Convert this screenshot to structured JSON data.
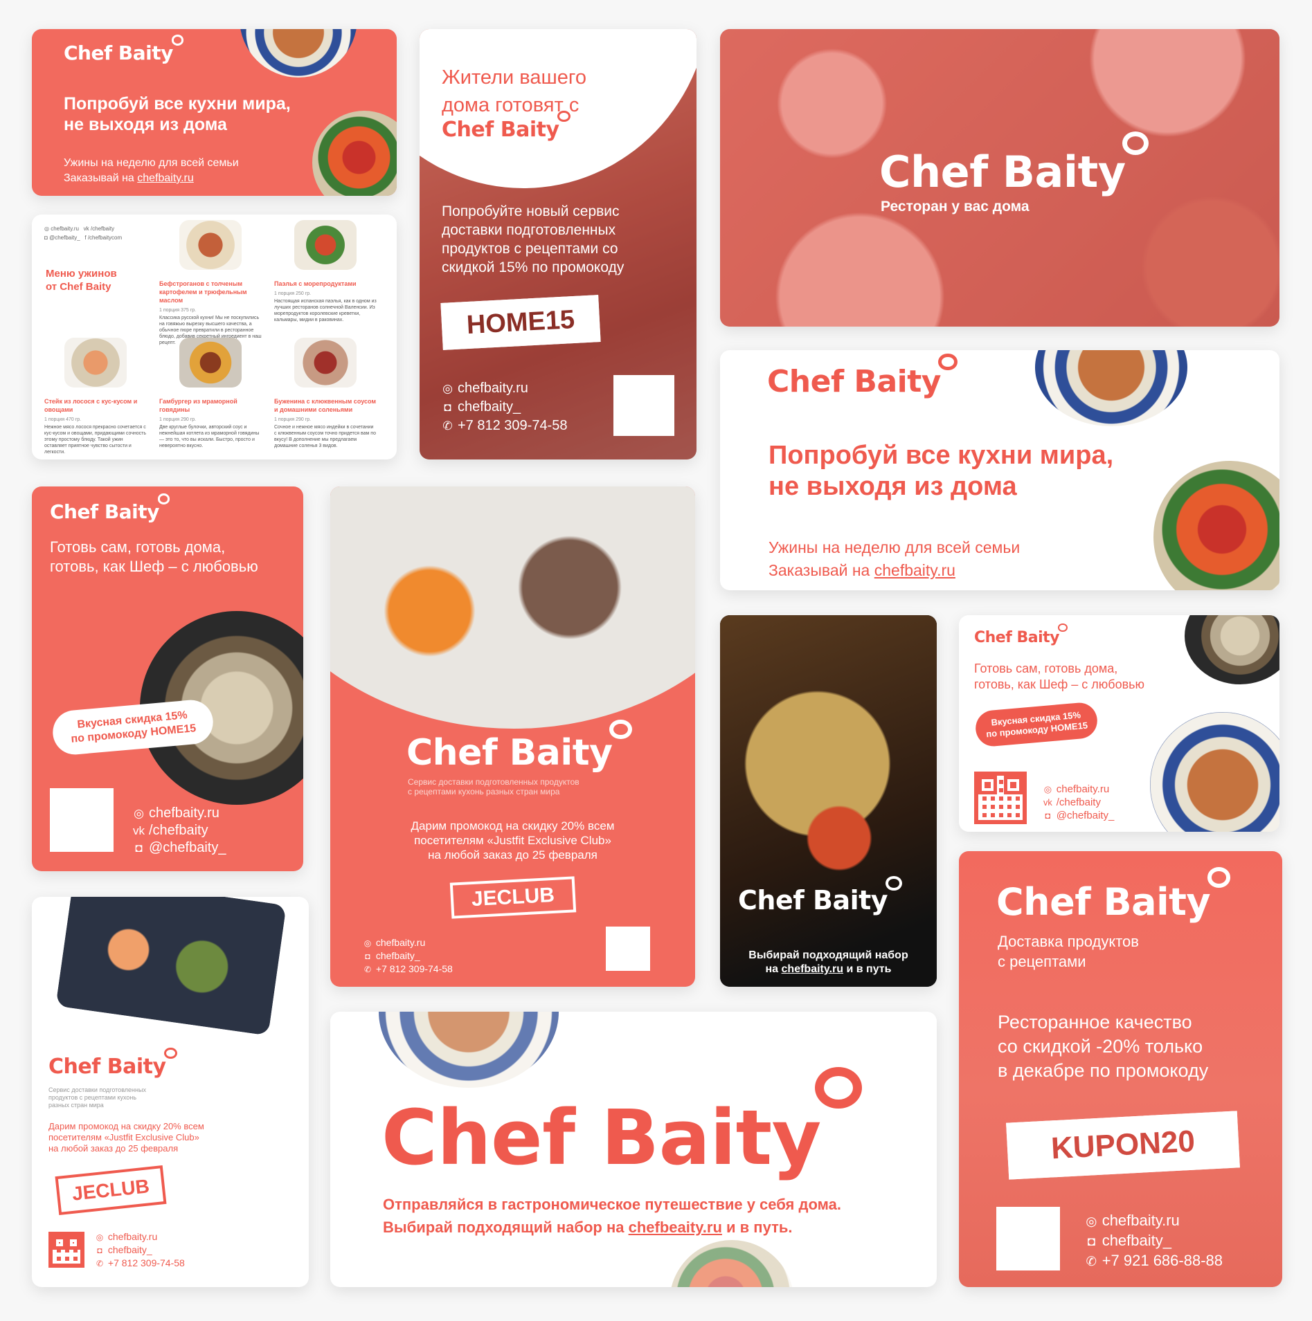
{
  "brand": {
    "name": "Chef Baity",
    "accent": "#f26a5e",
    "accent_text": "#ef5a4e"
  },
  "card1": {
    "headline": "Попробуй все кухни мира,\nне выходя из дома",
    "line1": "Ужины на неделю для всей семьи",
    "line2_prefix": "Заказывай на ",
    "link": "chefbaity.ru"
  },
  "card_menu": {
    "header": {
      "site": "chefbaity.ru",
      "insta": "@chefbaity_",
      "vk": "/chefbaity",
      "fb": "/chefbaitycom"
    },
    "title": "Меню ужинов\nот Chef Baity",
    "items": [
      {
        "title": "Бефстроганов с толченым картофелем и трюфельным маслом",
        "portion": "1 порция 375 гр.",
        "desc": "Классика русской кухни! Мы не поскупились на говяжью вырезку высшего качества, а обычное пюре превратили в ресторанное блюдо, добавив секретный ингредиент в наш рецепт."
      },
      {
        "title": "Паэлья с морепродуктами",
        "portion": "1 порция 250 гр.",
        "desc": "Настоящая испанская паэлья, как в одном из лучших ресторанов солнечной Валенсии. Из морепродуктов королевские креветки, кальмары, мидии в раковинах."
      },
      {
        "title": "Стейк из лосося с кус-кусом и овощами",
        "portion": "1 порция 470 гр.",
        "desc": "Нежное мясо лосося прекрасно сочетается с кус-кусом и овощами, придающими сочность этому простому блюду. Такой ужин оставляет приятное чувство сытости и легкости."
      },
      {
        "title": "Гамбургер из мраморной говядины",
        "portion": "1 порция 290 гр.",
        "desc": "Две круглые булочки, авторский соус и нежнейшая котлета из мраморной говядины — это то, что вы искали. Быстро, просто и невероятно вкусно."
      },
      {
        "title": "Буженина с клюквенным соусом и домашними соленьями",
        "portion": "1 порция 290 гр.",
        "desc": "Сочное и нежное мясо индейки в сочетании с клюквенным соусом точно придется вам по вкусу! В дополнение мы предлагаем домашние соленья 3 видов."
      }
    ]
  },
  "card_home": {
    "headline": "Жители вашего\nдома готовят с",
    "body": "Попробуйте новый сервис\nдоставки подготовленных\nпродуктов с рецептами со\nскидкой 15% по промокоду",
    "code": "HOME15",
    "site": "chefbaity.ru",
    "insta": "chefbaity_",
    "phone": "+7 812 309-74-58"
  },
  "card_hero": {
    "tagline": "Ресторан у вас дома"
  },
  "card_wide": {
    "headline": "Попробуй все кухни мира,\nне выходя из дома",
    "line1": "Ужины на неделю для всей семьи",
    "line2_prefix": "Заказывай на ",
    "link": "chefbaity.ru"
  },
  "card_cook": {
    "headline": "Готовь сам, готовь дома,\nготовь, как Шеф – с любовью",
    "pill": "Вкусная скидка 15%\nпо промокоду HOME15",
    "site": "chefbaity.ru",
    "vk": "/chefbaity",
    "insta": "@chefbaity_"
  },
  "card_steak": {
    "sub": "Сервис доставки подготовленных продуктов\nс рецептами кухонь разных стран мира",
    "promo": "Дарим промокод на скидку 20% всем\nпосетителям «Justfit Exclusive Club»\nна любой заказ до 25 февраля",
    "code": "JECLUB",
    "site": "chefbaity.ru",
    "insta": "chefbaity_",
    "phone": "+7 812 309-74-58"
  },
  "card_dark": {
    "line1": "Выбирай подходящий набор",
    "line2_prefix": "на ",
    "link": "chefbaity.ru",
    "line2_suffix": " и в путь"
  },
  "card_cook_small": {
    "headline": "Готовь сам, готовь дома,\nготовь, как Шеф – с любовью",
    "pill": "Вкусная скидка 15%\nпо промокоду HOME15",
    "site": "chefbaity.ru",
    "vk": "/chefbaity",
    "insta": "@chefbaity_"
  },
  "card_kupon": {
    "sub": "Доставка продуктов\nс рецептами",
    "body": "Ресторанное качество\nсо скидкой -20% только\nв декабре по промокоду",
    "code": "KUPON20",
    "site": "chefbaity.ru",
    "insta": "chefbaity_",
    "phone": "+7 921 686-88-88"
  },
  "card_jeclub": {
    "sub": "Сервис доставки подготовленных\nпродуктов с рецептами кухонь\nразных стран мира",
    "promo": "Дарим промокод на скидку 20% всем\nпосетителям «Justfit Exclusive Club»\nна любой заказ до 25 февраля",
    "code": "JECLUB",
    "site": "chefbaity.ru",
    "insta": "chefbaity_",
    "phone": "+7 812 309-74-58"
  },
  "card_banner": {
    "line1": "Отправляйся в гастрономическое путешествие у себя дома.",
    "line2_prefix": "Выбирай подходящий набор на ",
    "link": "chefbeaity.ru",
    "line2_suffix": " и в путь."
  }
}
